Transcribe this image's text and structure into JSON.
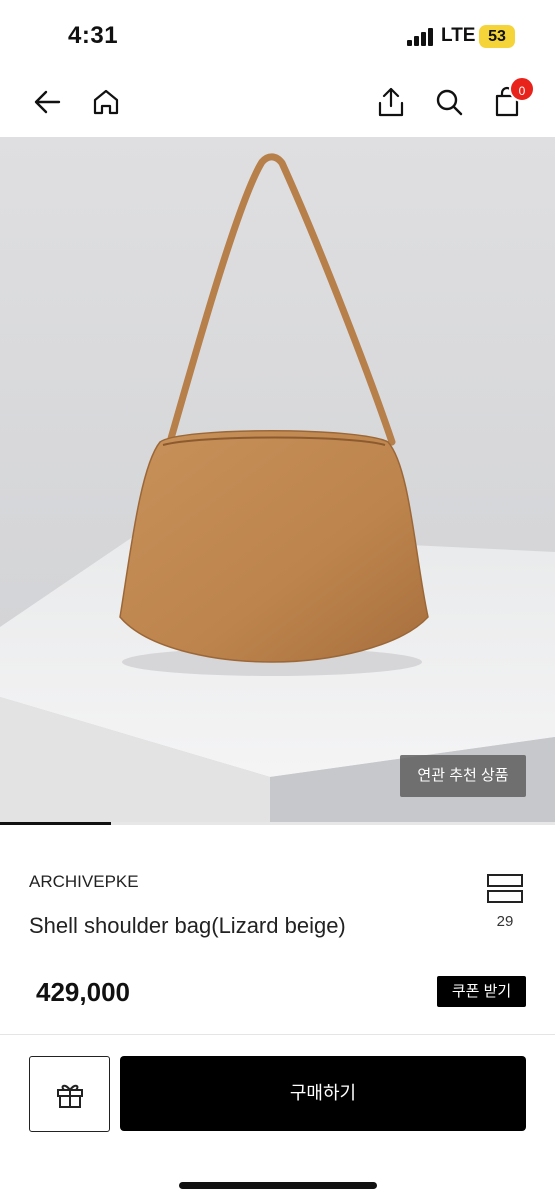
{
  "status_bar": {
    "time": "4:31",
    "network": "LTE",
    "battery": "53"
  },
  "nav": {
    "cart_count": "0"
  },
  "image": {
    "related_label": "연관 추천 상품",
    "carousel_progress": 0.2
  },
  "product": {
    "brand": "ARCHIVEPKE",
    "name": "Shell shoulder bag(Lizard beige)",
    "wishlist_count": "29",
    "price": "429,000",
    "coupon_label": "쿠폰 받기"
  },
  "actions": {
    "buy_label": "구매하기"
  },
  "colors": {
    "accent": "#000000",
    "badge": "#e8231b",
    "bag": "#c0874f"
  },
  "icons": [
    "back-arrow-icon",
    "home-icon",
    "share-icon",
    "search-icon",
    "shopping-bag-icon",
    "wishlist-icon",
    "gift-icon"
  ]
}
